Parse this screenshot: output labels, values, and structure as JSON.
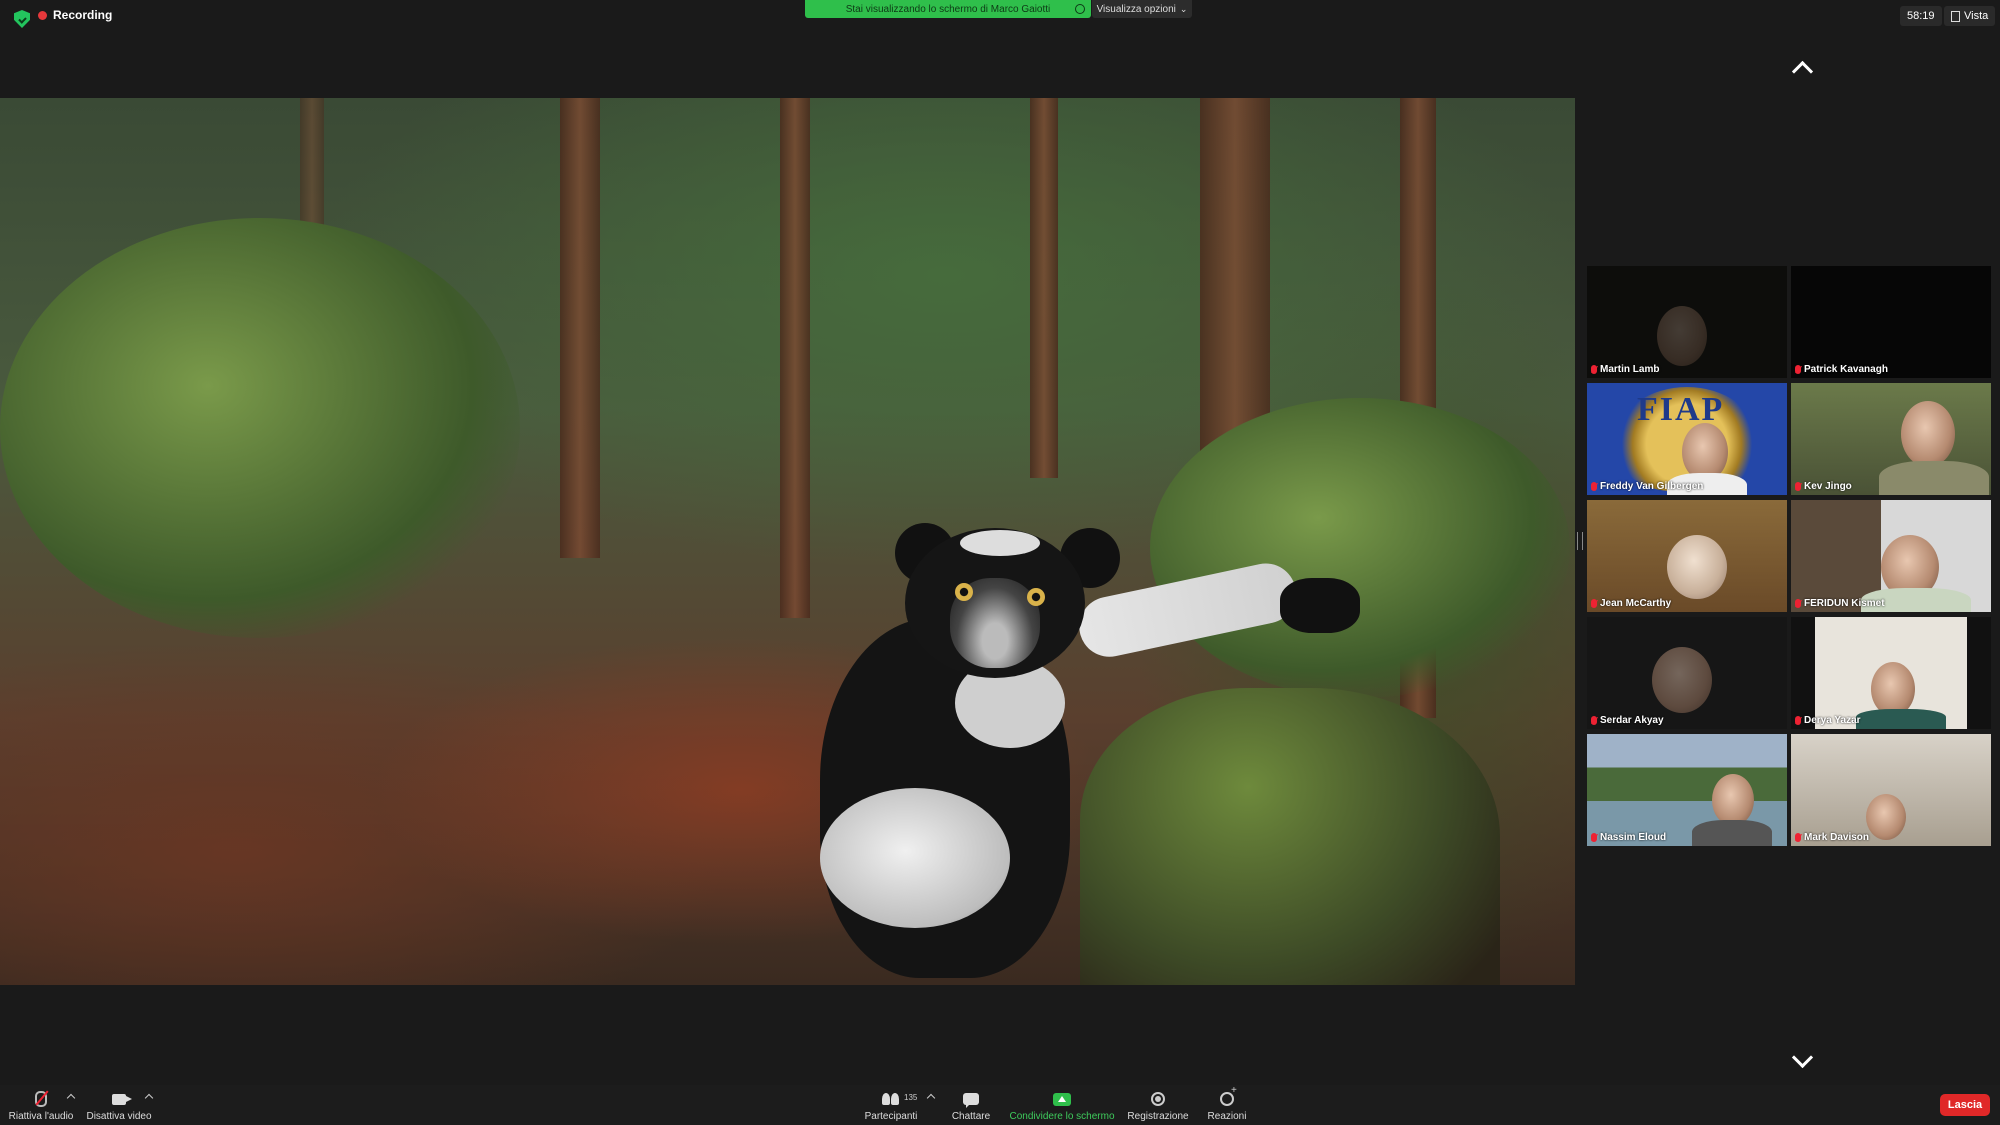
{
  "top_bar": {
    "recording_label": "Recording",
    "share_banner": "Stai visualizzando lo schermo di Marco Gaiotti",
    "view_options_label": "Visualizza opzioni",
    "timer": "58:19",
    "view_label": "Vista"
  },
  "gallery": {
    "participants": [
      {
        "name": "Martin Lamb",
        "muted": true
      },
      {
        "name": "Patrick Kavanagh",
        "muted": true
      },
      {
        "name": "Freddy Van Gilbergen",
        "muted": true
      },
      {
        "name": "Kev Jingo",
        "muted": true
      },
      {
        "name": "Jean McCarthy",
        "muted": true
      },
      {
        "name": "FERIDUN Kismet",
        "muted": true
      },
      {
        "name": "Serdar Akyay",
        "muted": true
      },
      {
        "name": "Derya Yazar",
        "muted": true
      },
      {
        "name": "Nassim Eloud",
        "muted": true
      },
      {
        "name": "Mark Davison",
        "muted": true
      }
    ],
    "fiap_logo_text": "FIAP"
  },
  "toolbar": {
    "unmute_label": "Riattiva l'audio",
    "video_label": "Disattiva video",
    "participants_label": "Partecipanti",
    "participants_count": "135",
    "chat_label": "Chattare",
    "share_label": "Condividere lo schermo",
    "record_label": "Registrazione",
    "reactions_label": "Reazioni",
    "leave_label": "Lascia"
  },
  "colors": {
    "share_green": "#2fbf4b",
    "leave_red": "#e02828",
    "background": "#1a1a1a"
  },
  "icons": [
    "shield-icon",
    "recording-dot-icon",
    "chevron-up-icon",
    "chevron-down-icon",
    "mic-muted-icon",
    "video-icon",
    "participants-icon",
    "chat-icon",
    "share-screen-icon",
    "record-icon",
    "reactions-icon"
  ]
}
